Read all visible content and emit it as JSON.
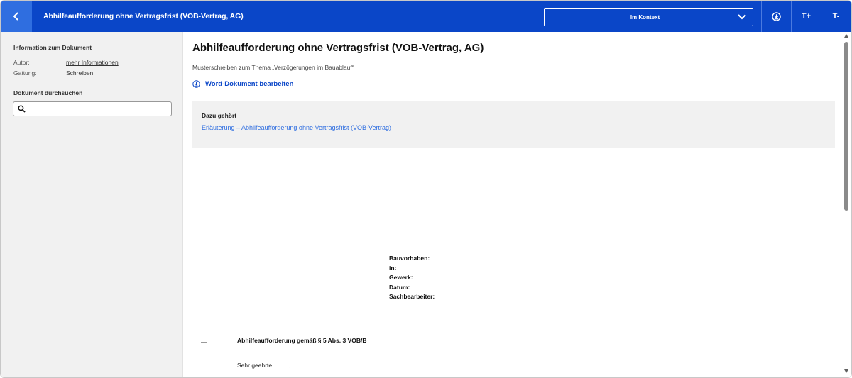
{
  "header": {
    "title": "Abhilfeaufforderung ohne Vertragsfrist (VOB-Vertrag, AG)",
    "context_select": "Im Kontext",
    "font_increase": "T+",
    "font_decrease": "T-"
  },
  "sidebar": {
    "info_heading": "Information zum Dokument",
    "author_label": "Autor:",
    "author_value": "mehr Informationen",
    "genre_label": "Gattung:",
    "genre_value": "Schreiben",
    "search_heading": "Dokument durchsuchen",
    "search_placeholder": ""
  },
  "document": {
    "title": "Abhilfeaufforderung ohne Vertragsfrist (VOB-Vertrag, AG)",
    "subtitle": "Musterschreiben zum Thema „Verzögerungen im Bauablauf“",
    "word_link": "Word-Dokument bearbeiten",
    "related_heading": "Dazu gehört",
    "related_link": "Erläuterung – Abhilfeaufforderung ohne Vertragsfrist (VOB-Vertrag)",
    "fields": [
      "Bauvorhaben:",
      "in:",
      "Gewerk:",
      "Datum:",
      "Sachbearbeiter:"
    ],
    "dash": "—",
    "subject": "Abhilfeaufforderung gemäß § 5 Abs. 3 VOB/B",
    "greeting": "Sehr geehrte",
    "greeting_end": ","
  },
  "colors": {
    "header_bg": "#0a46c8",
    "back_bg": "#2f6ee0",
    "link": "#2f6ee0",
    "sidebar_bg": "#f1f1f1"
  },
  "icons": {
    "back": "chevron-left-icon",
    "context": "chevron-down-icon",
    "download": "download-circle-icon",
    "search": "search-icon"
  }
}
